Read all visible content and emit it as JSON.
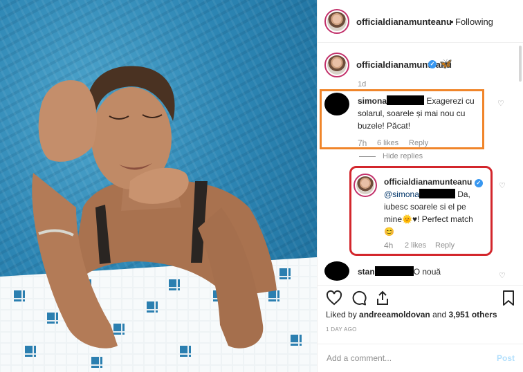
{
  "post": {
    "author": "officialdianamunteanu",
    "follow_sep": "•",
    "follow_state": "Following",
    "caption_emoji": "🦋",
    "age": "1d"
  },
  "comments": [
    {
      "user_prefix": "simona",
      "text_line1": "Exagerezi cu",
      "text_line2": "solarul, soarele și mai nou cu",
      "text_line3": "buzele! Păcat!",
      "age": "7h",
      "likes": "6 likes",
      "reply": "Reply"
    }
  ],
  "hide_replies": "Hide replies",
  "reply": {
    "user": "officialdianamunteanu",
    "mention": "@simona",
    "text_line1": "Da,",
    "text_line2": "iubesc soarele si el pe",
    "text_line3_start": "mine",
    "text_line3_emoji": "🌞",
    "text_line3_end": "♥! Perfect match",
    "text_line4": "😊",
    "age": "4h",
    "likes": "2 likes",
    "reply": "Reply"
  },
  "next_comment": {
    "user_prefix": "stan",
    "text": "O nouă"
  },
  "liked_by": {
    "prefix": "Liked by",
    "user": "andreeamoldovan",
    "and": "and",
    "others": "3,951 others"
  },
  "date": "1 DAY AGO",
  "composer": {
    "placeholder": "Add a comment...",
    "post": "Post"
  },
  "icons": [
    "heart-icon",
    "comment-icon",
    "share-icon",
    "bookmark-icon",
    "verified-icon",
    "like-comment-icon"
  ]
}
